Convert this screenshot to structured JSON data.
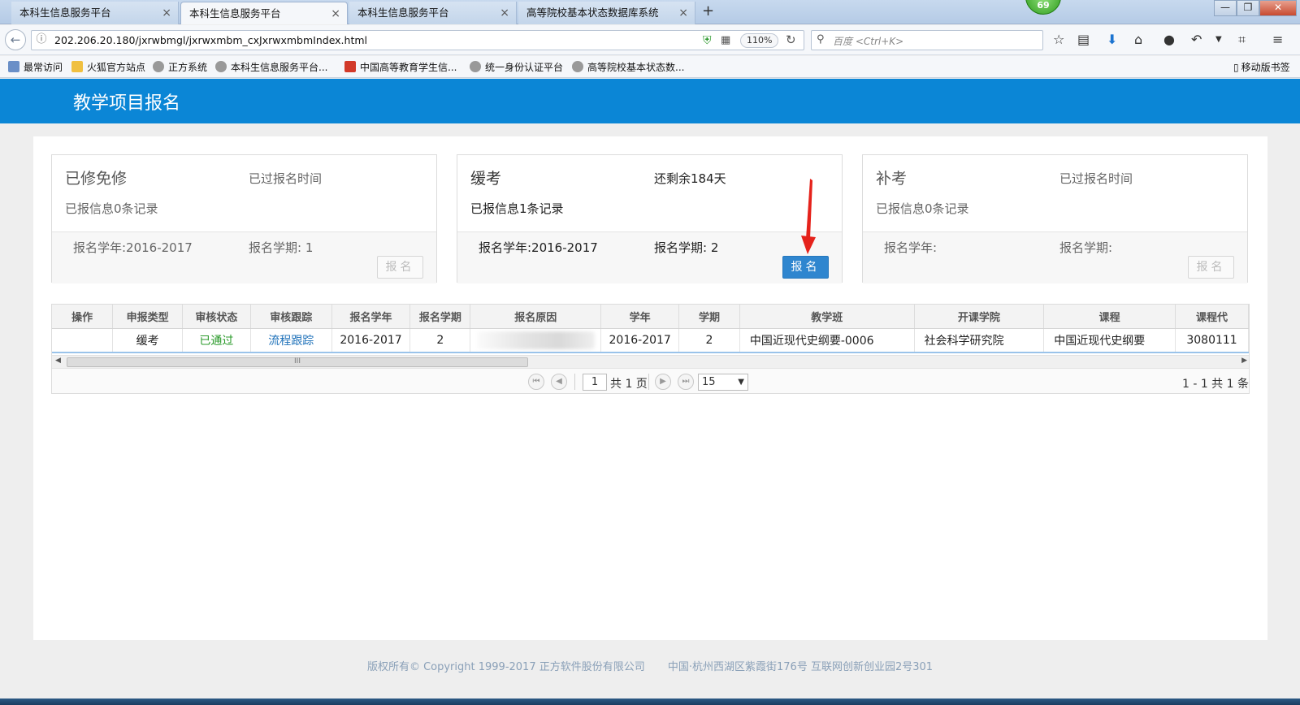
{
  "browser": {
    "tabs": [
      {
        "label": "本科生信息服务平台",
        "active": false
      },
      {
        "label": "本科生信息服务平台",
        "active": true
      },
      {
        "label": "本科生信息服务平台",
        "active": false
      },
      {
        "label": "高等院校基本状态数据库系统",
        "active": false
      }
    ],
    "tab_close": "×",
    "new_tab": "+",
    "badge_count": "69",
    "url": "202.206.20.180/jxrwbmgl/jxrwxmbm_cxJxrwxmbmIndex.html",
    "zoom": "110%",
    "search_placeholder": "百度 <Ctrl+K>",
    "bookmarks": [
      "最常访问",
      "火狐官方站点",
      "正方系统",
      "本科生信息服务平台...",
      "中国高等教育学生信...",
      "统一身份认证平台",
      "高等院校基本状态数..."
    ],
    "mobile_bookmarks": "移动版书签"
  },
  "page": {
    "title": "教学项目报名"
  },
  "cards": [
    {
      "title": "已修免修",
      "status": "已过报名时间",
      "records": "已报信息0条记录",
      "year": "报名学年:2016-2017",
      "term": "报名学期: 1",
      "button": "报名",
      "enabled": false
    },
    {
      "title": "缓考",
      "status": "还剩余184天",
      "records": "已报信息1条记录",
      "year": "报名学年:2016-2017",
      "term": "报名学期: 2",
      "button": "报名",
      "enabled": true
    },
    {
      "title": "补考",
      "status": "已过报名时间",
      "records": "已报信息0条记录",
      "year": "报名学年:",
      "term": "报名学期:",
      "button": "报名",
      "enabled": false
    }
  ],
  "grid": {
    "columns": [
      "操作",
      "申报类型",
      "审核状态",
      "审核跟踪",
      "报名学年",
      "报名学期",
      "报名原因",
      "学年",
      "学期",
      "教学班",
      "开课学院",
      "课程",
      "课程代"
    ],
    "rows": [
      {
        "operation": "",
        "type": "缓考",
        "status": "已通过",
        "tracking": "流程跟踪",
        "apply_year": "2016-2017",
        "apply_term": "2",
        "reason": "",
        "year": "2016-2017",
        "term": "2",
        "class": "中国近现代史纲要-0006",
        "college": "社会科学研究院",
        "course": "中国近现代史纲要",
        "course_code": "3080111"
      }
    ],
    "scroll_thumb_label": "III",
    "pager": {
      "current_page": "1",
      "total_pages": "共 1 页",
      "page_size": "15",
      "record_info": "1 - 1  共 1 条"
    }
  },
  "footer": {
    "copyright": "版权所有© Copyright 1999-2017 正方软件股份有限公司",
    "address": "中国·杭州西湖区紫霞街176号 互联网创新创业园2号301"
  },
  "colors": {
    "header_blue": "#0b86d6",
    "button_blue": "#2f86cf",
    "approved_green": "#2a9a2a",
    "annotation_red": "#e5221b"
  }
}
